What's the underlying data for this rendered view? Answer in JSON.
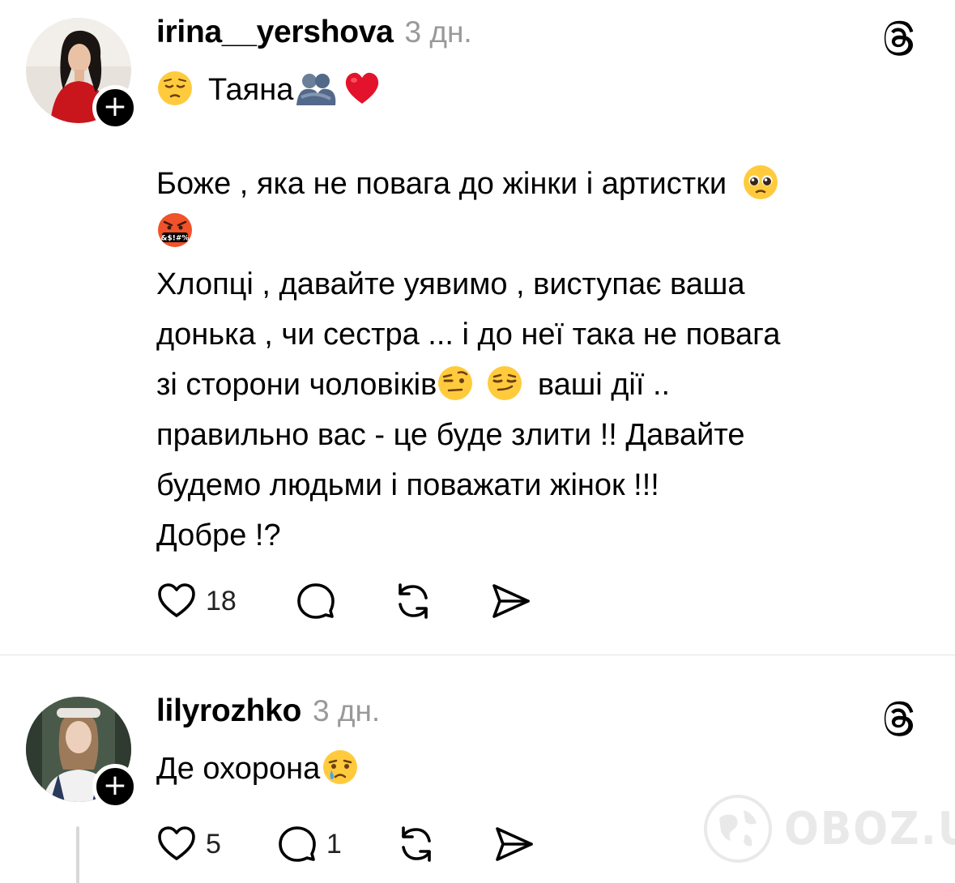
{
  "comments": [
    {
      "username": "irina__yershova",
      "time": "3 дн.",
      "lines": [
        "Таяна",
        "Боже , яка не повага до жінки і артистки",
        "Хлопці , давайте уявимо , виступає ваша",
        "донька , чи сестра ... і до неї така не повага",
        "зі сторони чоловіків",
        "ваші дії ..",
        "правильно вас - це буде злити !! Давайте",
        "будемо людьми і поважати жінок !!!",
        "Добре !?"
      ],
      "like_count": "18",
      "reply_count": ""
    },
    {
      "username": "lilyrozhko",
      "time": "3 дн.",
      "lines": [
        "Де охорона"
      ],
      "like_count": "5",
      "reply_count": "1"
    }
  ],
  "follow_symbol": "+",
  "watermark": {
    "text": "OBOZ.UA"
  },
  "icons": {
    "threads": "threads-logo-icon",
    "like": "heart-icon",
    "reply": "comment-icon",
    "repost": "repost-icon",
    "share": "send-icon"
  },
  "colors": {
    "text": "#000000",
    "muted": "#999999",
    "divider": "#e3e3e3"
  }
}
